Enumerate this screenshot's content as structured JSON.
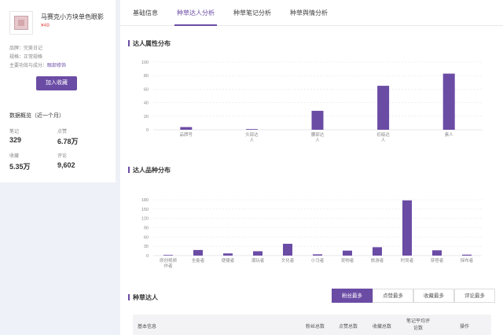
{
  "product": {
    "name": "马赛克小方块单色眼影",
    "price": "¥49",
    "brand_label": "品牌：",
    "brand": "完美日记",
    "spec_label": "规格：",
    "spec": "正常规格",
    "func_label": "主要功效与成分：",
    "func": "眼部修饰",
    "add_fav": "加入收藏"
  },
  "overview": {
    "title": "数据概览（近一个月）",
    "stats": [
      {
        "label": "笔记",
        "value": "329"
      },
      {
        "label": "点赞",
        "value": "6.78万"
      },
      {
        "label": "收藏",
        "value": "5.35万"
      },
      {
        "label": "评论",
        "value": "9,602"
      }
    ]
  },
  "tabs": [
    "基础信息",
    "种草达人分析",
    "种草笔记分析",
    "种草舆情分析"
  ],
  "active_tab": 1,
  "sections": {
    "attr": "达人属性分布",
    "kind": "达人品种分布",
    "list": "种草达人"
  },
  "sort_buttons": [
    "粉丝最多",
    "点赞最多",
    "收藏最多",
    "评论最多"
  ],
  "table_headers": [
    "基本信息",
    "粉丝总数",
    "点赞总数",
    "收藏总数",
    "笔记平均评论数",
    "操作"
  ],
  "colors": {
    "accent": "#6b4ca5",
    "bar": "#6b4ca5"
  },
  "chart_data": [
    {
      "type": "bar",
      "title": "达人属性分布",
      "categories": [
        "品牌号",
        "头部达人",
        "腰部达人",
        "初级达人",
        "素人"
      ],
      "values": [
        4,
        1,
        28,
        65,
        83
      ],
      "ylim": [
        0,
        100
      ],
      "yticks": [
        0,
        20,
        40,
        60,
        80,
        100
      ],
      "grid": true
    },
    {
      "type": "bar",
      "title": "达人品种分布",
      "categories": [
        "原创视频作者",
        "全能者",
        "便捷者",
        "潮玩者",
        "文化者",
        "小马者",
        "宠物者",
        "旅游者",
        "时尚者",
        "穿搭者",
        "探布者"
      ],
      "values": [
        2,
        18,
        7,
        14,
        38,
        4,
        16,
        27,
        178,
        17,
        3
      ],
      "ylim": [
        0,
        180
      ],
      "yticks": [
        0,
        30,
        60,
        90,
        120,
        150,
        180
      ],
      "grid": true
    }
  ]
}
